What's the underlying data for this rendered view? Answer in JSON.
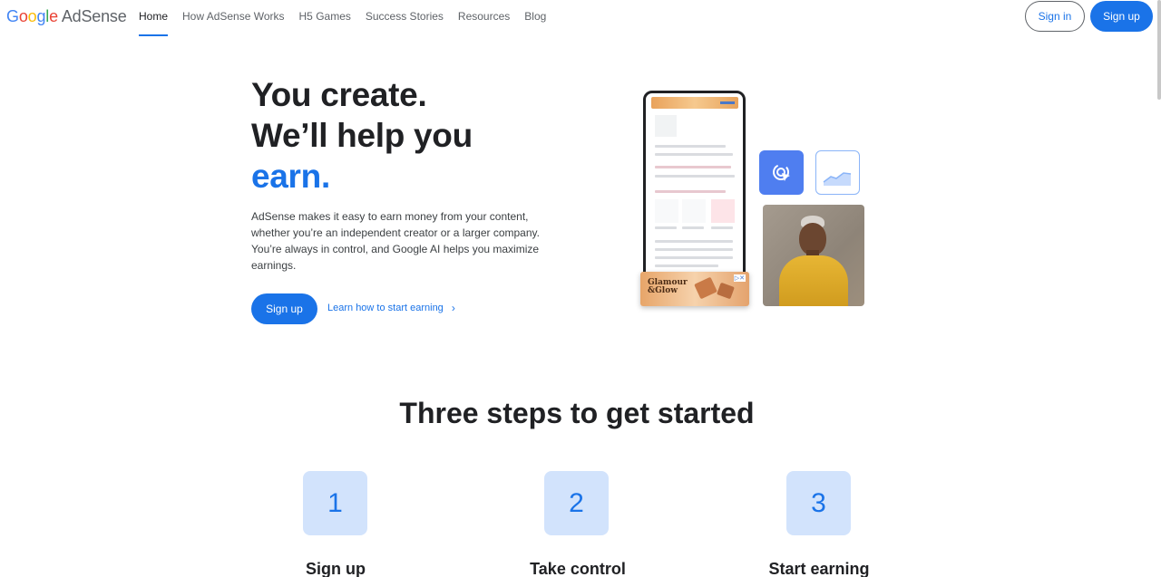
{
  "header": {
    "logo": {
      "google": [
        "G",
        "o",
        "o",
        "g",
        "l",
        "e"
      ],
      "product": "AdSense"
    },
    "nav": [
      {
        "label": "Home",
        "active": true
      },
      {
        "label": "How AdSense Works",
        "active": false
      },
      {
        "label": "H5 Games",
        "active": false
      },
      {
        "label": "Success Stories",
        "active": false
      },
      {
        "label": "Resources",
        "active": false
      },
      {
        "label": "Blog",
        "active": false
      }
    ],
    "sign_in": "Sign in",
    "sign_up": "Sign up"
  },
  "hero": {
    "line1": "You create.",
    "line2": "We’ll help you",
    "line3": "earn.",
    "description": "AdSense makes it easy to earn money from your content, whether you’re an independent creator or a larger company. You’re always in control, and Google AI helps you maximize earnings.",
    "sign_up": "Sign up",
    "learn_link": "Learn how to start earning"
  },
  "illustration": {
    "ad_text_line1": "Glamour",
    "ad_text_line2": "&Glow",
    "ad_choice": "▷✕"
  },
  "steps": {
    "title": "Three steps to get started",
    "items": [
      {
        "number": "1",
        "label": "Sign up"
      },
      {
        "number": "2",
        "label": "Take control"
      },
      {
        "number": "3",
        "label": "Start earning"
      }
    ]
  },
  "colors": {
    "accent": "#1a73e8",
    "step_tile": "#d2e3fc"
  }
}
